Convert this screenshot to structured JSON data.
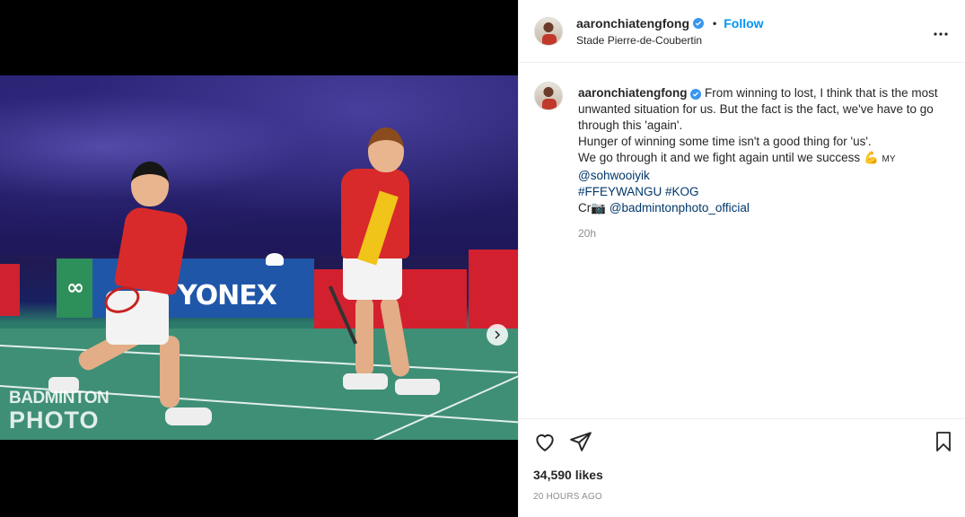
{
  "post": {
    "username": "aaronchiatengfong",
    "verified": true,
    "separator": "•",
    "follow_label": "Follow",
    "location": "Stade Pierre-de-Coubertin",
    "more_icon": "more-horizontal-icon",
    "media": {
      "watermark_line1": "BADMINTON",
      "watermark_line2": "PHOTO",
      "ad_text": "YONEX",
      "carousel_total": 2,
      "carousel_active": 1
    },
    "caption": {
      "line1": "From winning to lost, I think that is the most unwanted situation for us. But the fact is the fact, we've have to go through this 'again'.",
      "line2": "Hunger of winning some time isn't a good thing for 'us'.",
      "line3_pre": "We go through it and we fight again until we success",
      "line3_emoji": "💪",
      "line3_post": "MY",
      "mention1": "@sohwooiyik",
      "hashtags": "#FFEYWANGU #KOG",
      "credit_prefix": "Cr",
      "credit_emoji": "📷",
      "mention2": "@badmintonphoto_official",
      "relative_time": "20h"
    },
    "likes": "34,590 likes",
    "posted_ago": "20 HOURS AGO",
    "colors": {
      "follow": "#0095f6",
      "verified": "#3897f0",
      "link": "#00376b",
      "meta": "#8e8e8e"
    }
  }
}
